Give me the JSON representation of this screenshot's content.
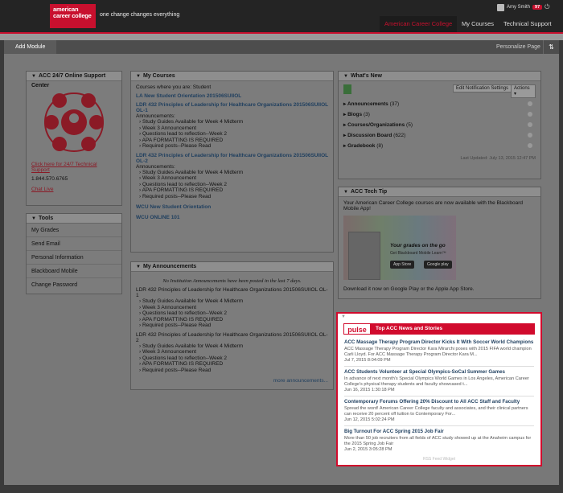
{
  "header": {
    "logo_text": "american career college",
    "tagline": "one change changes everything",
    "user_name": "Amy Smith",
    "notif_count": "97",
    "power_symbol": "⏻",
    "tabs": [
      "American Career College",
      "My Courses",
      "Technical Support"
    ]
  },
  "actionbar": {
    "add_module": "Add Module",
    "personalize": "Personalize Page",
    "sort_symbol": "⇅"
  },
  "support": {
    "title": "ACC 24/7 Online Support Center",
    "link_label": "Click here for 24/7 Technical Support",
    "phone": "1.844.570.6765",
    "chat": "Chat Live"
  },
  "tools": {
    "title": "Tools",
    "items": [
      "My Grades",
      "Send Email",
      "Personal Information",
      "Blackboard Mobile",
      "Change Password"
    ]
  },
  "courses": {
    "title": "My Courses",
    "role_note": "Courses where you are: Student",
    "entries": [
      {
        "title": "LA New Student Orientation 201506SUIIOL",
        "ann": "",
        "items": []
      },
      {
        "title": "LDR 432 Principles of Leadership for Healthcare Organizations 201506SUIIOL OL-1",
        "ann": "Announcements:",
        "items": [
          "Study Guides Available for Week 4 Midterm",
          "Week 3 Announcement",
          "Questions lead to reflection--Week 2",
          "APA FORMATTING IS REQUIRED",
          "Required posts--Please Read"
        ]
      },
      {
        "title": "LDR 432 Principles of Leadership for Healthcare Organizations 201506SUIIOL OL-2",
        "ann": "Announcements:",
        "items": [
          "Study Guides Available for Week 4 Midterm",
          "Week 3 Announcement",
          "Questions lead to reflection--Week 2",
          "APA FORMATTING IS REQUIRED",
          "Required posts--Please Read"
        ]
      },
      {
        "title": "WCU New Student Orientation",
        "ann": "",
        "items": []
      },
      {
        "title": "WCU ONLINE 101",
        "ann": "",
        "items": []
      }
    ]
  },
  "announcements": {
    "title": "My Announcements",
    "note": "No Institution Announcements have been posted in the last 7 days.",
    "groups": [
      {
        "course": "LDR 432 Principles of Leadership for Healthcare Organizations 201506SUIIOL OL-1",
        "items": [
          "Study Guides Available for Week 4 Midterm",
          "Week 3 Announcement",
          "Questions lead to reflection--Week 2",
          "APA FORMATTING IS REQUIRED",
          "Required posts--Please Read"
        ]
      },
      {
        "course": "LDR 432 Principles of Leadership for Healthcare Organizations 201506SUIIOL OL-2",
        "items": [
          "Study Guides Available for Week 4 Midterm",
          "Week 3 Announcement",
          "Questions lead to reflection--Week 2",
          "APA FORMATTING IS REQUIRED",
          "Required posts--Please Read"
        ]
      }
    ],
    "more": "more announcements..."
  },
  "whatsnew": {
    "title": "What's New",
    "edit_btn": "Edit Notification Settings",
    "actions_btn": "Actions",
    "rows": [
      {
        "label": "Announcements",
        "count": "(37)"
      },
      {
        "label": "Blogs",
        "count": "(3)"
      },
      {
        "label": "Courses/Organizations",
        "count": "(5)"
      },
      {
        "label": "Discussion Board",
        "count": "(622)"
      },
      {
        "label": "Gradebook",
        "count": "(8)"
      }
    ],
    "updated": "Last Updated: July 13, 2015 12:47 PM"
  },
  "techtip": {
    "title": "ACC Tech Tip",
    "intro": "Your American Career College courses are now available with the Blackboard Mobile App!",
    "promo_title": "Your grades on the go",
    "promo_sub": "Get Blackboard Mobile Learn™",
    "app_store": "App Store",
    "google_play": "Google play",
    "download_note": "Download it now on Google Play or the Apple App Store."
  },
  "pulse": {
    "logo": "pulse",
    "title": "Top ACC News and Stories",
    "stories": [
      {
        "title": "ACC Massage Therapy Program Director Kicks It With Soccer World Champions",
        "excerpt": "ACC Massage Therapy Program Director Kara Mirarchi poses with 2015 FIFA world champion Carli Lloyd. For ACC Massage Therapy Program Director Kara M...",
        "date": "Jul 7, 2015 8:04:09 PM"
      },
      {
        "title": "ACC Students Volunteer at Special Olympics-SoCal Summer Games",
        "excerpt": "In advance of next month's Special Olympics World Games in Los Angeles, American Career College's physical therapy students and faculty showcased t...",
        "date": "Jun 16, 2015 1:30:18 PM"
      },
      {
        "title": "Contemporary Forums Offering 20% Discount to All ACC Staff and Faculty",
        "excerpt": "Spread the word! American Career College faculty and associates, and their clinical partners can receive 20 percent off tuition to Contemporary For...",
        "date": "Jun 12, 2015 5:02:24 PM"
      },
      {
        "title": "Big Turnout For ACC Spring 2015 Job Fair",
        "excerpt": "More than 50 job recruiters from all fields of ACC study showed up at the Anaheim campus for the 2015 Spring Job Fair",
        "date": "Jun 2, 2015 3:05:28 PM"
      }
    ],
    "footer": "RSS Feed Widget"
  },
  "colors": {
    "brand_red": "#c8102e",
    "dim_overlay": "#787878"
  }
}
